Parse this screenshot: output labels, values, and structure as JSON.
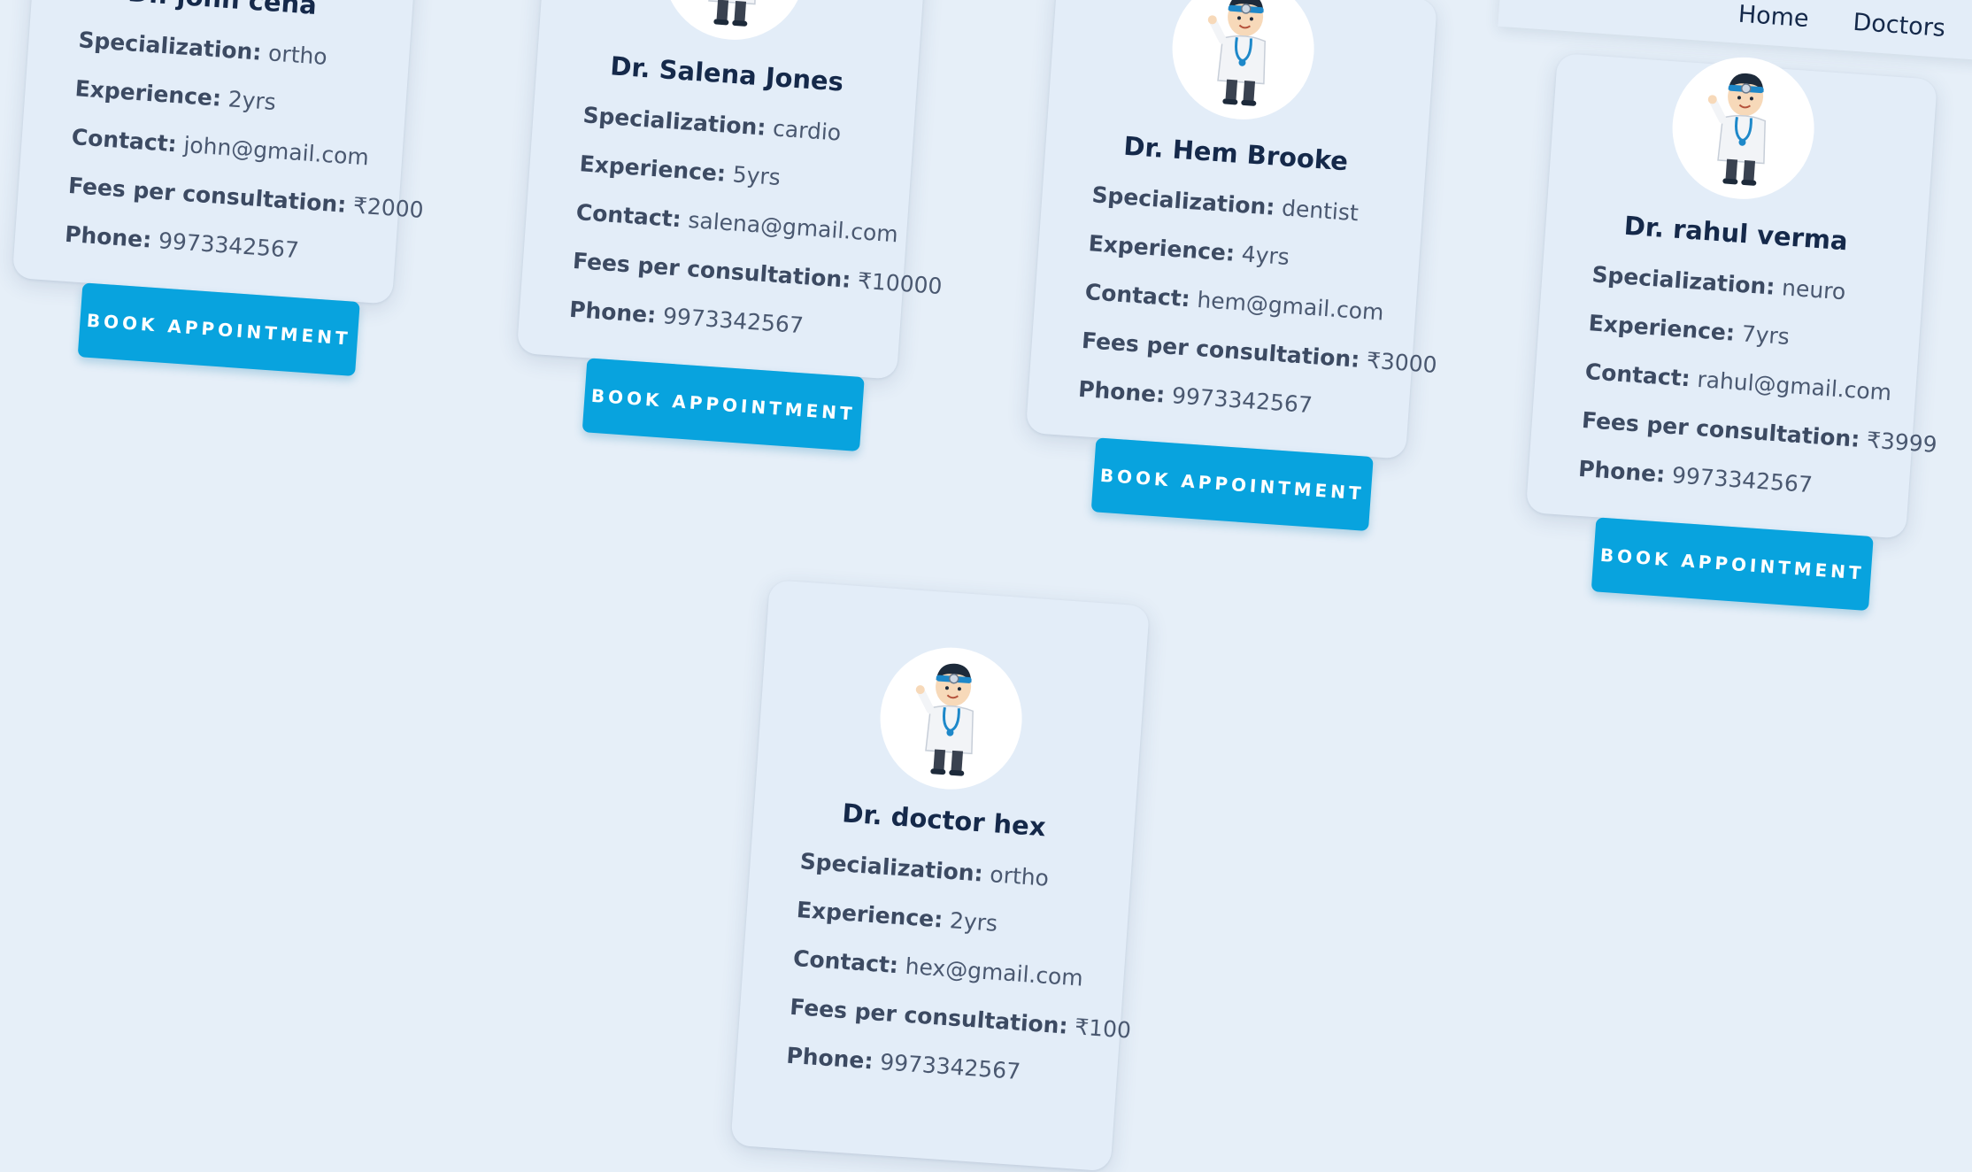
{
  "nav": {
    "home": "Home",
    "doctors": "Doctors"
  },
  "labels": {
    "specialization": "Specialization:",
    "experience": "Experience:",
    "contact": "Contact:",
    "fees": "Fees per consultation:",
    "phone": "Phone:",
    "book": "BOOK APPOINTMENT"
  },
  "doctors": [
    {
      "name": "Dr. john cena",
      "specialization": "ortho",
      "experience": "2yrs",
      "contact": "john@gmail.com",
      "fees": "₹2000",
      "phone": "9973342567"
    },
    {
      "name": "Dr. Salena Jones",
      "specialization": "cardio",
      "experience": "5yrs",
      "contact": "salena@gmail.com",
      "fees": "₹10000",
      "phone": "9973342567"
    },
    {
      "name": "Dr. Hem Brooke",
      "specialization": "dentist",
      "experience": "4yrs",
      "contact": "hem@gmail.com",
      "fees": "₹3000",
      "phone": "9973342567"
    },
    {
      "name": "Dr. rahul verma",
      "specialization": "neuro",
      "experience": "7yrs",
      "contact": "rahul@gmail.com",
      "fees": "₹3999",
      "phone": "9973342567"
    },
    {
      "name": "Dr. doctor hex",
      "specialization": "ortho",
      "experience": "2yrs",
      "contact": "hex@gmail.com",
      "fees": "₹100",
      "phone": "9973342567"
    }
  ]
}
